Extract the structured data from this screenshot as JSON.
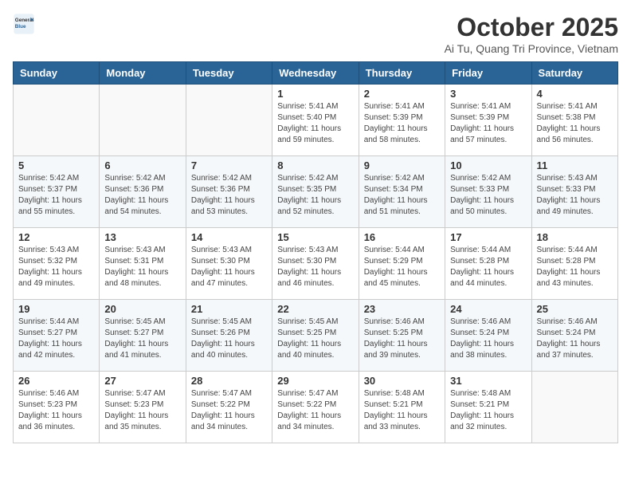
{
  "header": {
    "logo_general": "General",
    "logo_blue": "Blue",
    "month_title": "October 2025",
    "location": "Ai Tu, Quang Tri Province, Vietnam"
  },
  "days_of_week": [
    "Sunday",
    "Monday",
    "Tuesday",
    "Wednesday",
    "Thursday",
    "Friday",
    "Saturday"
  ],
  "weeks": [
    [
      {
        "day": "",
        "info": ""
      },
      {
        "day": "",
        "info": ""
      },
      {
        "day": "",
        "info": ""
      },
      {
        "day": "1",
        "info": "Sunrise: 5:41 AM\nSunset: 5:40 PM\nDaylight: 11 hours\nand 59 minutes."
      },
      {
        "day": "2",
        "info": "Sunrise: 5:41 AM\nSunset: 5:39 PM\nDaylight: 11 hours\nand 58 minutes."
      },
      {
        "day": "3",
        "info": "Sunrise: 5:41 AM\nSunset: 5:39 PM\nDaylight: 11 hours\nand 57 minutes."
      },
      {
        "day": "4",
        "info": "Sunrise: 5:41 AM\nSunset: 5:38 PM\nDaylight: 11 hours\nand 56 minutes."
      }
    ],
    [
      {
        "day": "5",
        "info": "Sunrise: 5:42 AM\nSunset: 5:37 PM\nDaylight: 11 hours\nand 55 minutes."
      },
      {
        "day": "6",
        "info": "Sunrise: 5:42 AM\nSunset: 5:36 PM\nDaylight: 11 hours\nand 54 minutes."
      },
      {
        "day": "7",
        "info": "Sunrise: 5:42 AM\nSunset: 5:36 PM\nDaylight: 11 hours\nand 53 minutes."
      },
      {
        "day": "8",
        "info": "Sunrise: 5:42 AM\nSunset: 5:35 PM\nDaylight: 11 hours\nand 52 minutes."
      },
      {
        "day": "9",
        "info": "Sunrise: 5:42 AM\nSunset: 5:34 PM\nDaylight: 11 hours\nand 51 minutes."
      },
      {
        "day": "10",
        "info": "Sunrise: 5:42 AM\nSunset: 5:33 PM\nDaylight: 11 hours\nand 50 minutes."
      },
      {
        "day": "11",
        "info": "Sunrise: 5:43 AM\nSunset: 5:33 PM\nDaylight: 11 hours\nand 49 minutes."
      }
    ],
    [
      {
        "day": "12",
        "info": "Sunrise: 5:43 AM\nSunset: 5:32 PM\nDaylight: 11 hours\nand 49 minutes."
      },
      {
        "day": "13",
        "info": "Sunrise: 5:43 AM\nSunset: 5:31 PM\nDaylight: 11 hours\nand 48 minutes."
      },
      {
        "day": "14",
        "info": "Sunrise: 5:43 AM\nSunset: 5:30 PM\nDaylight: 11 hours\nand 47 minutes."
      },
      {
        "day": "15",
        "info": "Sunrise: 5:43 AM\nSunset: 5:30 PM\nDaylight: 11 hours\nand 46 minutes."
      },
      {
        "day": "16",
        "info": "Sunrise: 5:44 AM\nSunset: 5:29 PM\nDaylight: 11 hours\nand 45 minutes."
      },
      {
        "day": "17",
        "info": "Sunrise: 5:44 AM\nSunset: 5:28 PM\nDaylight: 11 hours\nand 44 minutes."
      },
      {
        "day": "18",
        "info": "Sunrise: 5:44 AM\nSunset: 5:28 PM\nDaylight: 11 hours\nand 43 minutes."
      }
    ],
    [
      {
        "day": "19",
        "info": "Sunrise: 5:44 AM\nSunset: 5:27 PM\nDaylight: 11 hours\nand 42 minutes."
      },
      {
        "day": "20",
        "info": "Sunrise: 5:45 AM\nSunset: 5:27 PM\nDaylight: 11 hours\nand 41 minutes."
      },
      {
        "day": "21",
        "info": "Sunrise: 5:45 AM\nSunset: 5:26 PM\nDaylight: 11 hours\nand 40 minutes."
      },
      {
        "day": "22",
        "info": "Sunrise: 5:45 AM\nSunset: 5:25 PM\nDaylight: 11 hours\nand 40 minutes."
      },
      {
        "day": "23",
        "info": "Sunrise: 5:46 AM\nSunset: 5:25 PM\nDaylight: 11 hours\nand 39 minutes."
      },
      {
        "day": "24",
        "info": "Sunrise: 5:46 AM\nSunset: 5:24 PM\nDaylight: 11 hours\nand 38 minutes."
      },
      {
        "day": "25",
        "info": "Sunrise: 5:46 AM\nSunset: 5:24 PM\nDaylight: 11 hours\nand 37 minutes."
      }
    ],
    [
      {
        "day": "26",
        "info": "Sunrise: 5:46 AM\nSunset: 5:23 PM\nDaylight: 11 hours\nand 36 minutes."
      },
      {
        "day": "27",
        "info": "Sunrise: 5:47 AM\nSunset: 5:23 PM\nDaylight: 11 hours\nand 35 minutes."
      },
      {
        "day": "28",
        "info": "Sunrise: 5:47 AM\nSunset: 5:22 PM\nDaylight: 11 hours\nand 34 minutes."
      },
      {
        "day": "29",
        "info": "Sunrise: 5:47 AM\nSunset: 5:22 PM\nDaylight: 11 hours\nand 34 minutes."
      },
      {
        "day": "30",
        "info": "Sunrise: 5:48 AM\nSunset: 5:21 PM\nDaylight: 11 hours\nand 33 minutes."
      },
      {
        "day": "31",
        "info": "Sunrise: 5:48 AM\nSunset: 5:21 PM\nDaylight: 11 hours\nand 32 minutes."
      },
      {
        "day": "",
        "info": ""
      }
    ]
  ]
}
